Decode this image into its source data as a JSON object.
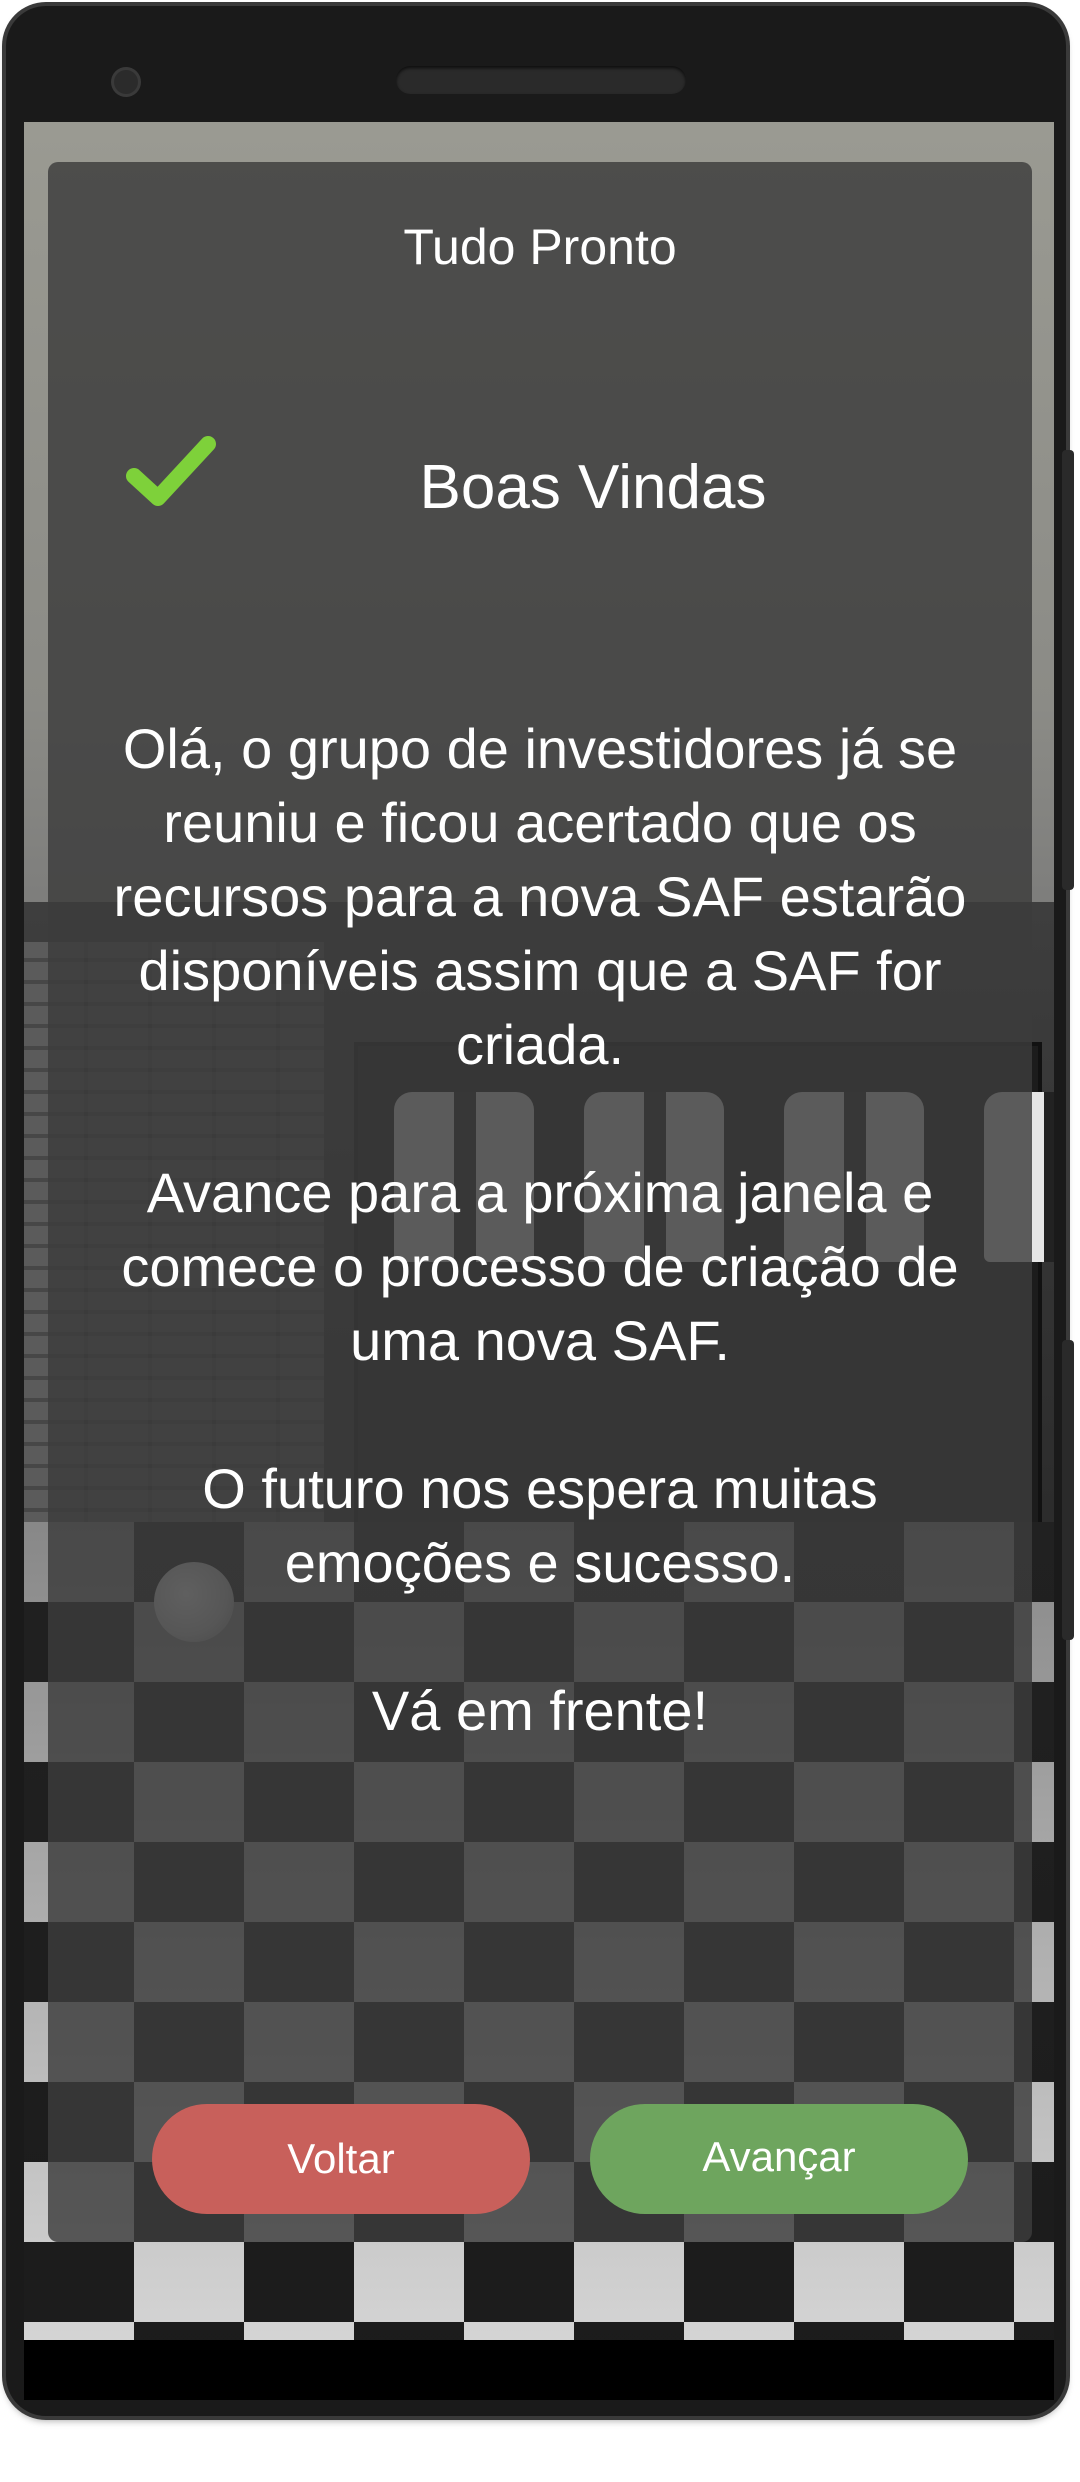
{
  "dialog": {
    "title": "Tudo Pronto",
    "headline": "Boas Vindas",
    "check_icon": "check-icon",
    "check_color": "#7ed13a",
    "paragraphs": [
      "Olá, o grupo de investidores já se reuniu e ficou acertado que os recursos para a nova SAF estarão disponíveis assim que a SAF for criada.",
      "Avance para a próxima janela e comece o processo de criação de uma nova SAF.",
      "O futuro nos espera muitas emoções e sucesso.",
      "Vá em frente!"
    ]
  },
  "buttons": {
    "back_label": "Voltar",
    "back_color": "#c8605b",
    "next_label": "Avançar",
    "next_color": "#6ea55e"
  }
}
